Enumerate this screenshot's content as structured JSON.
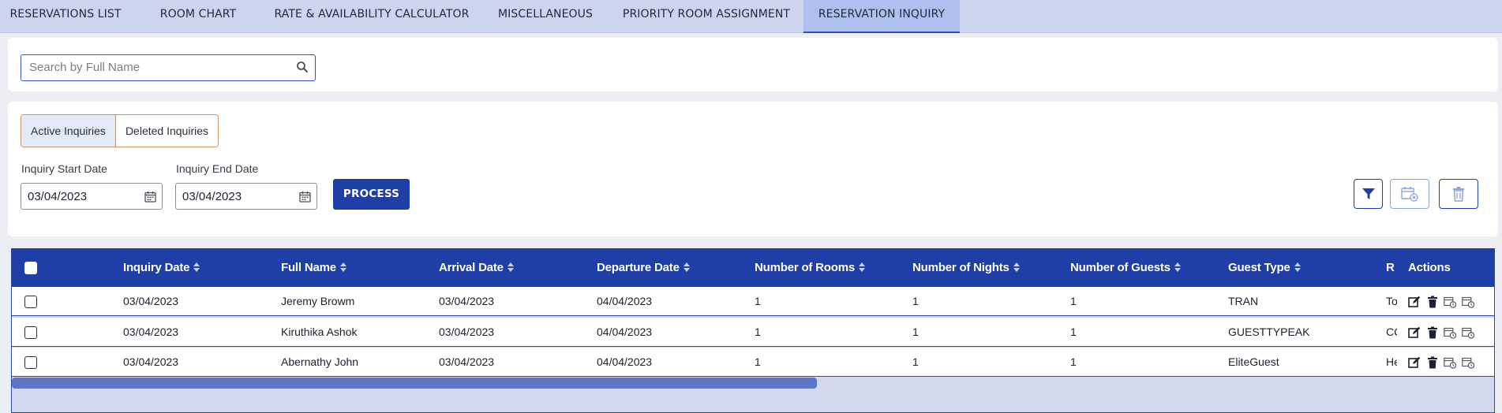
{
  "nav": {
    "tabs": [
      {
        "label": "RESERVATIONS LIST"
      },
      {
        "label": "ROOM CHART"
      },
      {
        "label": "RATE & AVAILABILITY CALCULATOR"
      },
      {
        "label": "MISCELLANEOUS"
      },
      {
        "label": "PRIORITY ROOM ASSIGNMENT"
      },
      {
        "label": "RESERVATION INQUIRY"
      }
    ],
    "active_tab": "RESERVATION INQUIRY"
  },
  "search": {
    "placeholder": "Search by Full Name",
    "value": ""
  },
  "filters": {
    "segments": [
      "Active Inquiries",
      "Deleted Inquiries"
    ],
    "selected_segment": "Active Inquiries",
    "start_date_label": "Inquiry Start Date",
    "start_date": "03/04/2023",
    "end_date_label": "Inquiry End Date",
    "end_date": "03/04/2023",
    "process_label": "PROCESS"
  },
  "table": {
    "columns": [
      "Inquiry Date",
      "Full Name",
      "Arrival Date",
      "Departure Date",
      "Number of Rooms",
      "Number of Nights",
      "Number of Guests",
      "Guest Type",
      "R",
      "Actions"
    ],
    "rows": [
      {
        "inquiry_date": "03/04/2023",
        "full_name": "Jeremy Browm",
        "arrival_date": "03/04/2023",
        "departure_date": "04/04/2023",
        "rooms": "1",
        "nights": "1",
        "guests": "1",
        "guest_type": "TRAN",
        "r": "To"
      },
      {
        "inquiry_date": "03/04/2023",
        "full_name": "Kiruthika Ashok",
        "arrival_date": "03/04/2023",
        "departure_date": "04/04/2023",
        "rooms": "1",
        "nights": "1",
        "guests": "1",
        "guest_type": "GUESTTYPEAK",
        "r": "CC"
      },
      {
        "inquiry_date": "03/04/2023",
        "full_name": "Abernathy John",
        "arrival_date": "03/04/2023",
        "departure_date": "04/04/2023",
        "rooms": "1",
        "nights": "1",
        "guests": "1",
        "guest_type": "EliteGuest",
        "r": "He"
      }
    ]
  },
  "colors": {
    "nav_bg": "#cdd5ee",
    "active_tab_bg": "#aebff0",
    "primary": "#1f3fa6",
    "scrollbar": "#5d76c7"
  },
  "icons": {
    "search": "search-icon",
    "calendar": "calendar-icon",
    "filter": "filter-icon",
    "calendar_delete": "calendar-x-icon",
    "trash": "trash-icon",
    "edit": "edit-icon",
    "calendar_add": "calendar-plus-icon",
    "calendar_clock": "calendar-clock-icon"
  }
}
